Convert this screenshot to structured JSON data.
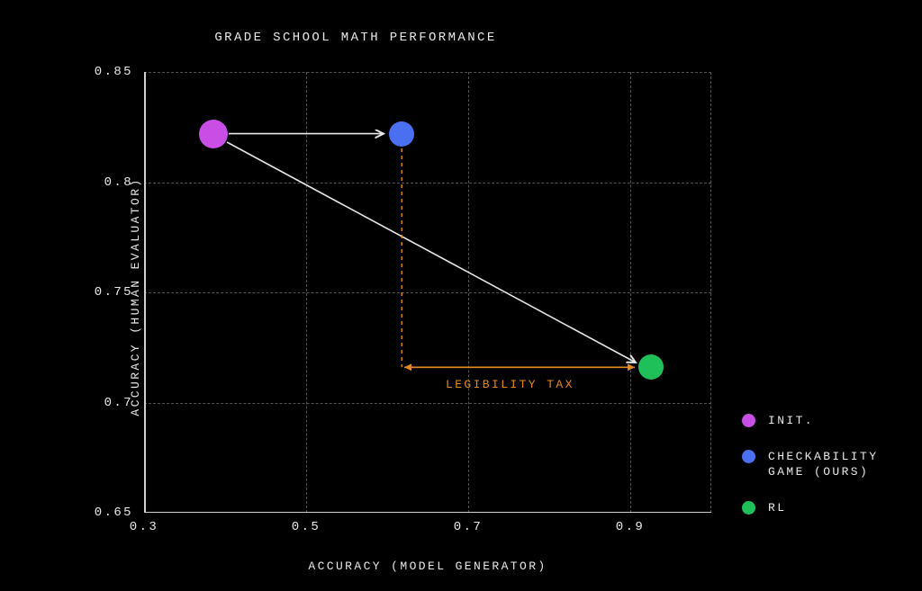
{
  "chart_data": {
    "type": "scatter",
    "title": "GRADE SCHOOL MATH PERFORMANCE",
    "xlabel": "ACCURACY (MODEL GENERATOR)",
    "ylabel": "ACCURACY (HUMAN EVALUATOR)",
    "xlim": [
      0.3,
      1.0
    ],
    "ylim": [
      0.65,
      0.85
    ],
    "xticks": [
      0.3,
      0.5,
      0.7,
      0.9
    ],
    "yticks": [
      0.65,
      0.7,
      0.75,
      0.8,
      0.85
    ],
    "series": [
      {
        "name": "INIT.",
        "x": 0.385,
        "y": 0.822,
        "color": "#c84ee6"
      },
      {
        "name": "CHECKABILITY\nGAME (OURS)",
        "x": 0.618,
        "y": 0.822,
        "color": "#4a6ff0"
      },
      {
        "name": "RL",
        "x": 0.925,
        "y": 0.716,
        "color": "#1fbf5a"
      }
    ],
    "arrows": [
      {
        "from": "INIT.",
        "to": "CHECKABILITY GAME (OURS)"
      },
      {
        "from": "INIT.",
        "to": "RL"
      }
    ],
    "annotation": {
      "label": "LEGIBILITY TAX",
      "span_x": [
        0.618,
        0.925
      ],
      "at_y": 0.716
    },
    "legend": {
      "items": [
        {
          "label": "INIT.",
          "color": "#c84ee6"
        },
        {
          "label": "CHECKABILITY GAME (OURS)",
          "color": "#4a6ff0"
        },
        {
          "label": "RL",
          "color": "#1fbf5a"
        }
      ]
    }
  },
  "tick_labels": {
    "x": [
      "0.3",
      "0.5",
      "0.7",
      "0.9"
    ],
    "y": [
      "0.65",
      "0.7",
      "0.75",
      "0.8",
      "0.85"
    ]
  },
  "legend_labels": {
    "init": "INIT.",
    "ours_line1": "CHECKABILITY",
    "ours_line2": "GAME (OURS)",
    "rl": "RL"
  },
  "annotation_label": "LEGIBILITY TAX"
}
